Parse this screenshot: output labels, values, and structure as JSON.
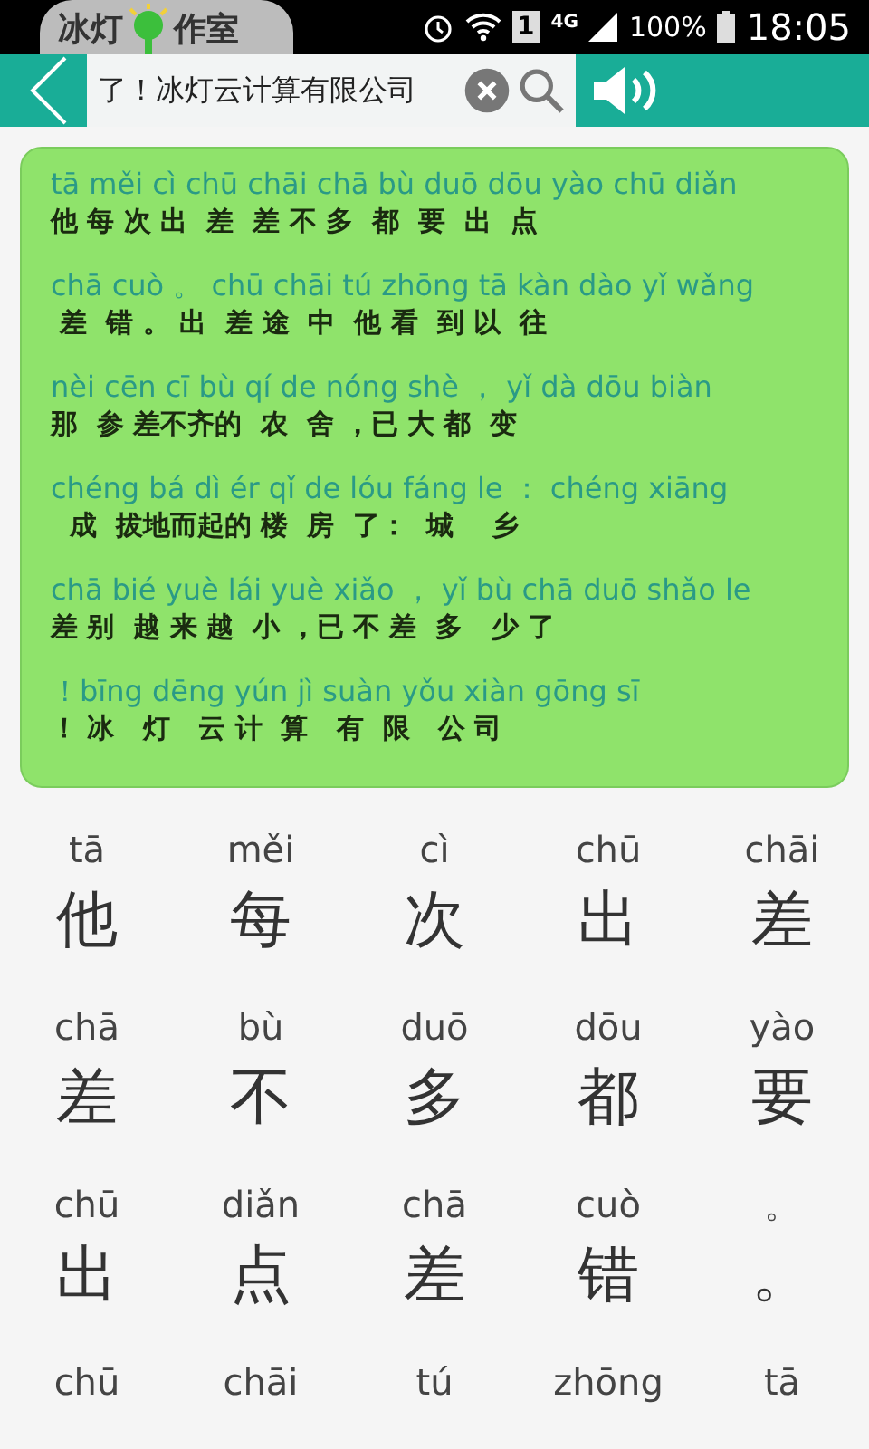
{
  "status_bar": {
    "logo_left": "冰灯",
    "logo_right": "作室",
    "sim": "1",
    "network": "4G",
    "battery": "100%",
    "time": "18:05"
  },
  "search": {
    "value": "了！冰灯云计算有限公司"
  },
  "passage": [
    {
      "pinyin": "tā měi cì chū chāi chā bù duō dōu yào chū diǎn",
      "hanzi": "他 每 次 出  差  差 不 多  都  要  出  点"
    },
    {
      "pinyin": "chā cuò 。 chū chāi tú zhōng tā kàn dào yǐ wǎng",
      "hanzi": " 差  错 。 出  差 途  中  他 看  到 以  往"
    },
    {
      "pinyin": "nèi cēn cī bù qí de nóng shè ， yǐ dà dōu biàn",
      "hanzi": "那  参 差不齐的  农  舍 ，已 大 都  变"
    },
    {
      "pinyin": "chéng bá dì ér qǐ de lóu fáng le ： chéng xiāng",
      "hanzi": "  成  拔地而起的 楼  房  了：  城    乡"
    },
    {
      "pinyin": "chā bié yuè lái yuè xiǎo ， yǐ bù chā duō shǎo le",
      "hanzi": "差 别  越 来 越  小 ，已 不 差  多   少 了"
    },
    {
      "pinyin": "！bīng dēng yún jì suàn yǒu xiàn gōng sī",
      "hanzi": "！ 冰   灯   云 计  算   有  限   公 司"
    }
  ],
  "characters": [
    {
      "pinyin": "tā",
      "char": "他"
    },
    {
      "pinyin": "měi",
      "char": "每"
    },
    {
      "pinyin": "cì",
      "char": "次"
    },
    {
      "pinyin": "chū",
      "char": "出"
    },
    {
      "pinyin": "chāi",
      "char": "差"
    },
    {
      "pinyin": "chā",
      "char": "差"
    },
    {
      "pinyin": "bù",
      "char": "不"
    },
    {
      "pinyin": "duō",
      "char": "多"
    },
    {
      "pinyin": "dōu",
      "char": "都"
    },
    {
      "pinyin": "yào",
      "char": "要"
    },
    {
      "pinyin": "chū",
      "char": "出"
    },
    {
      "pinyin": "diǎn",
      "char": "点"
    },
    {
      "pinyin": "chā",
      "char": "差"
    },
    {
      "pinyin": "cuò",
      "char": "错"
    },
    {
      "pinyin": "。",
      "char": "。"
    },
    {
      "pinyin": "chū"
    },
    {
      "pinyin": "chāi"
    },
    {
      "pinyin": "tú"
    },
    {
      "pinyin": "zhōng"
    },
    {
      "pinyin": "tā"
    }
  ]
}
